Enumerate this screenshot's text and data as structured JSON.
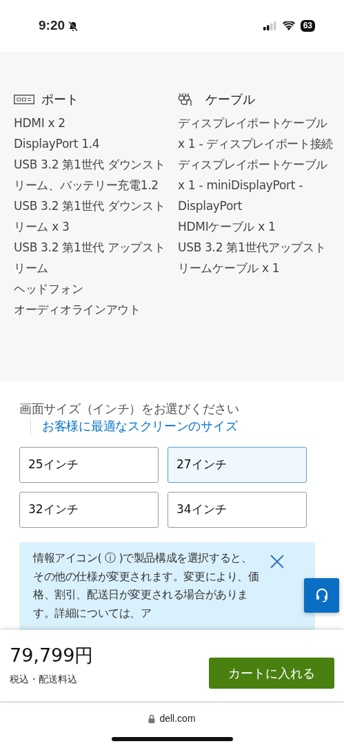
{
  "status_bar": {
    "time": "9:20",
    "battery": "63"
  },
  "specs": {
    "columns": [
      {
        "kind": "ports",
        "title": "ポート",
        "items": [
          "HDMI x 2",
          "DisplayPort 1.4",
          "USB 3.2 第1世代 ダウンストリーム、バッテリー充電1.2",
          "USB 3.2 第1世代 ダウンストリーム x 3",
          "USB 3.2 第1世代 アップストリーム",
          "ヘッドフォン",
          "オーディオラインアウト"
        ]
      },
      {
        "kind": "cables",
        "title": "ケーブル",
        "items": [
          "ディスプレイポートケーブル x 1 - ディスプレイポート接続",
          "ディスプレイポートケーブル x 1 - miniDisplayPort - DisplayPort",
          "HDMIケーブル x 1",
          "USB 3.2 第1世代アップストリームケーブル x 1"
        ]
      }
    ]
  },
  "size_selector": {
    "title": "画面サイズ（インチ）をお選びください",
    "link": "お客様に最適なスクリーンのサイズ",
    "options": [
      {
        "label": "25インチ",
        "selected": false
      },
      {
        "label": "27インチ",
        "selected": true
      },
      {
        "label": "32インチ",
        "selected": false
      },
      {
        "label": "34インチ",
        "selected": false
      }
    ]
  },
  "info_banner": {
    "text": "情報アイコン( ⓘ )で製品構成を選択すると、その他の仕様が変更されます。変更により、価格、割引、配送日が変更される場合があります。詳細については、ア"
  },
  "purchase_bar": {
    "price": "79,799円",
    "note": "税込・配送料込",
    "button": "カートに入れる"
  },
  "browser": {
    "url": "dell.com"
  }
}
